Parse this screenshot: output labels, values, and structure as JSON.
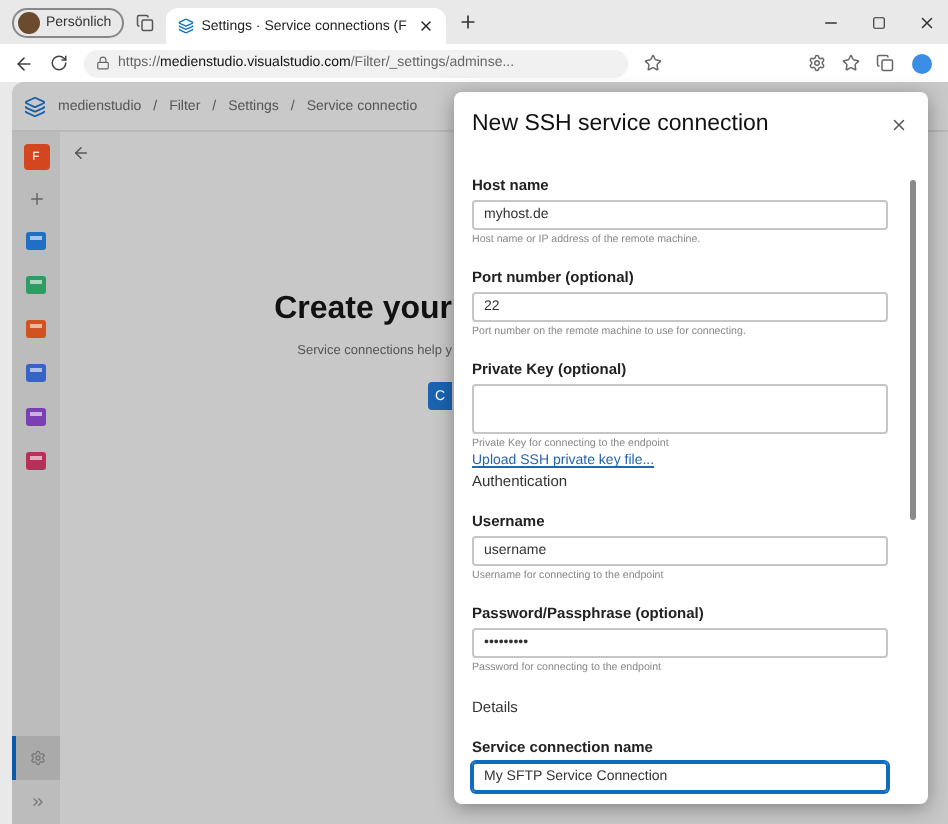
{
  "browser": {
    "profile": "Persönlich",
    "tab_title": "Settings · Service connections (F",
    "url": "https://**medienstudio.visualstudio.com**/Filter/_settings/adminse..."
  },
  "header": {
    "separator": "/",
    "breadcrumbs": [
      "medienstudio",
      "Filter",
      "Settings",
      "Service connectio"
    ]
  },
  "rail": {
    "project_badge": "F",
    "settings_selected": true
  },
  "page": {
    "heading": "Create your",
    "description": "Service connections help y",
    "button": "C"
  },
  "dialog": {
    "title": "New SSH service connection",
    "items": [
      {
        "kind": "field",
        "label": "Host name",
        "value": "myhost.de",
        "helper": "Host name or IP address of the remote machine.",
        "focused": false
      },
      {
        "kind": "field",
        "label": "Port number (optional)",
        "value": "22",
        "helper": "Port number on the remote machine to use for connecting.",
        "focused": false
      },
      {
        "kind": "textarea",
        "label": "Private Key (optional)",
        "helper": "Private Key for connecting to the endpoint",
        "focused": false
      },
      {
        "kind": "link",
        "text": "Upload SSH private key file..."
      },
      {
        "kind": "section",
        "text": "Authentication"
      },
      {
        "kind": "field",
        "label": "Username",
        "value": "username",
        "helper": "Username for connecting to the endpoint",
        "focused": false
      },
      {
        "kind": "field",
        "label": "Password/Passphrase (optional)",
        "value": "•••••••••",
        "helper": "Password for connecting to the endpoint",
        "focused": false
      },
      {
        "kind": "section",
        "text": "Details"
      },
      {
        "kind": "field",
        "label": "Service connection name",
        "value": "My SFTP Service Connection",
        "focused": true
      }
    ]
  }
}
